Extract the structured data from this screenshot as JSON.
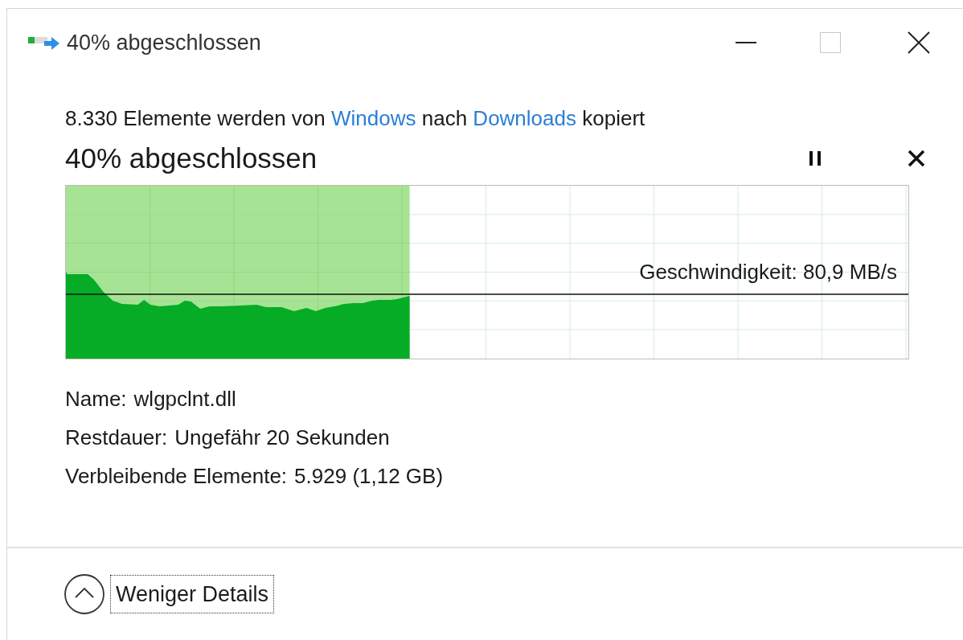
{
  "window": {
    "title": "40% abgeschlossen"
  },
  "summary": {
    "parts": [
      {
        "kind": "text",
        "text": "8.330 Elemente werden von"
      },
      {
        "kind": "link",
        "text": "Windows"
      },
      {
        "kind": "text",
        "text": "nach"
      },
      {
        "kind": "link",
        "text": "Downloads"
      },
      {
        "kind": "text",
        "text": "kopiert"
      }
    ]
  },
  "progress": {
    "heading": "40% abgeschlossen",
    "level": 0.408,
    "speed": "Geschwindigkeit: 80,9 MB/s"
  },
  "details": [
    {
      "label": "Name:",
      "value": "wlgpclnt.dll"
    },
    {
      "label": "Restdauer:",
      "value": "Ungefähr 20 Sekunden"
    },
    {
      "label": "Verbleibende Elemente:",
      "value": "5.929 (1,12 GB)"
    }
  ],
  "footer": {
    "toggle": "Weniger Details",
    "expanded": true
  }
}
